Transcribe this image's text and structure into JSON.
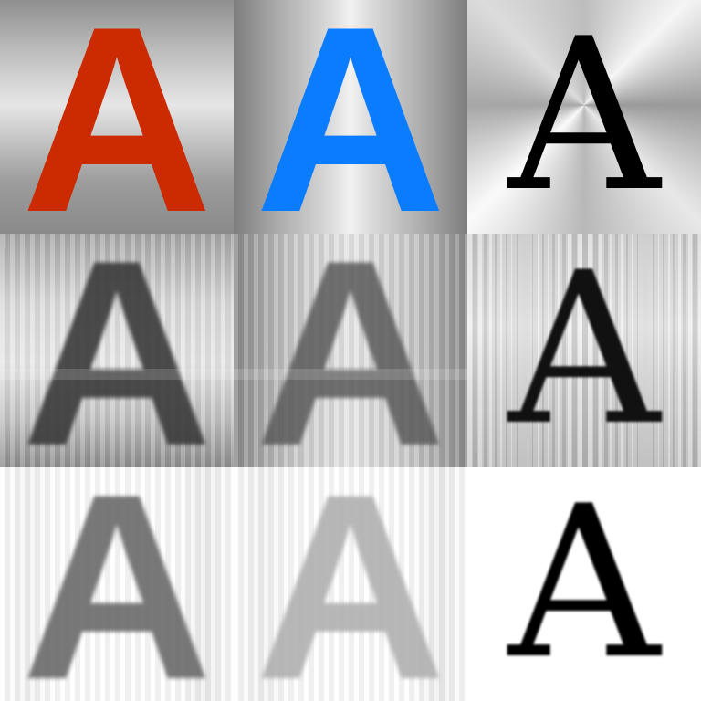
{
  "tiles": [
    {
      "id": "r1c1",
      "glyph": "A",
      "color": "#cc2a00",
      "background": "horizontal-brushed-metal"
    },
    {
      "id": "r1c2",
      "glyph": "A",
      "color": "#0a7cff",
      "background": "vertical-brushed-metal"
    },
    {
      "id": "r1c3",
      "glyph": "A",
      "color": "#000000",
      "background": "conical-brushed-metal"
    },
    {
      "id": "r2c1",
      "glyph": "A",
      "color": "#3a3a3a",
      "background": "horizontal-brushed-metal",
      "style": "smeared"
    },
    {
      "id": "r2c2",
      "glyph": "A",
      "color": "#5a5a5a",
      "background": "vertical-brushed-metal",
      "style": "smeared"
    },
    {
      "id": "r2c3",
      "glyph": "A",
      "color": "#111111",
      "background": "streaked-metal",
      "style": "smeared"
    },
    {
      "id": "r3c1",
      "glyph": "A",
      "color": "#6a6a6a",
      "background": "white",
      "style": "smeared"
    },
    {
      "id": "r3c2",
      "glyph": "A",
      "color": "#b0b0b0",
      "background": "white",
      "style": "smeared"
    },
    {
      "id": "r3c3",
      "glyph": "A",
      "color": "#000000",
      "background": "white",
      "style": "smeared"
    }
  ]
}
